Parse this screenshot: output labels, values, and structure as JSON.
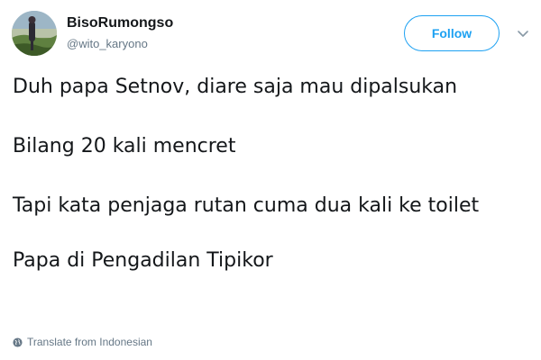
{
  "user": {
    "display_name": "BisoRumongso",
    "handle": "@wito_karyono"
  },
  "follow_label": "Follow",
  "icons": {
    "dropdown": "chevron-down-icon",
    "translate": "globe-icon"
  },
  "tweet": {
    "line1": "Duh papa Setnov, diare saja mau dipalsukan",
    "line2": "Bilang 20 kali mencret",
    "line3": "Tapi kata penjaga rutan cuma dua kali ke toilet",
    "line4": "Papa di Pengadilan Tipikor"
  },
  "translate_label": "Translate from Indonesian",
  "colors": {
    "accent": "#1da1f2",
    "secondary_text": "#657786",
    "primary_text": "#14171a"
  }
}
